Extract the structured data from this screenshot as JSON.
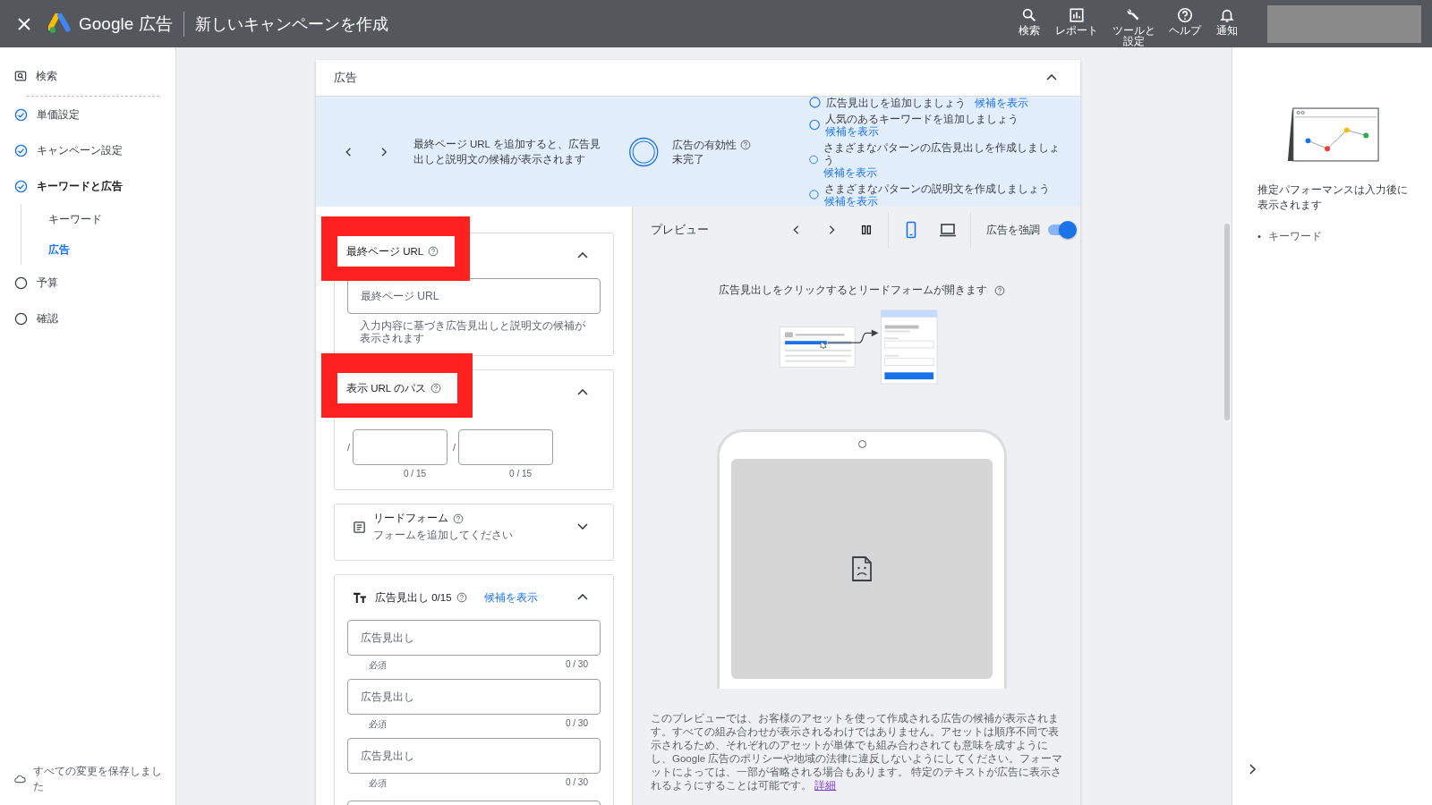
{
  "topbar": {
    "brand": "Google 広告",
    "title": "新しいキャンペーンを作成",
    "nav": [
      {
        "label": "検索",
        "kind": "search"
      },
      {
        "label": "レポート",
        "kind": "report"
      },
      {
        "label": "ツールと設定",
        "kind": "tools"
      },
      {
        "label": "ヘルプ",
        "kind": "help"
      },
      {
        "label": "通知",
        "kind": "bell"
      }
    ]
  },
  "sidebar": {
    "items": [
      {
        "label": "検索",
        "kind": "search",
        "selected": false
      },
      {
        "label": "単価設定",
        "kind": "done",
        "selected": false
      },
      {
        "label": "キャンペーン設定",
        "kind": "done",
        "selected": false
      },
      {
        "label": "キーワードと広告",
        "kind": "done",
        "selected": true,
        "children": [
          {
            "label": "キーワード",
            "selected": false
          },
          {
            "label": "広告",
            "selected": true
          }
        ]
      },
      {
        "label": "予算",
        "kind": "todo",
        "selected": false
      },
      {
        "label": "確認",
        "kind": "todo",
        "selected": false
      }
    ],
    "saved_status": "すべての変更を保存しました"
  },
  "card": {
    "title": "広告",
    "expanded": true,
    "banner": {
      "message": "最終ページ URL を追加すると、広告見出しと説明文の候補が表示されます",
      "effectiveness_label": "広告の有効性",
      "effectiveness_status": "未完了",
      "suggestions": [
        {
          "text": "広告見出しを追加しましょう",
          "link": "候補を表示"
        },
        {
          "text": "人気のあるキーワードを追加しましょう",
          "link": "候補を表示"
        },
        {
          "text": "さまざまなパターンの広告見出しを作成しましょう",
          "link": "候補を表示"
        },
        {
          "text": "さまざまなパターンの説明文を作成しましょう",
          "link": "候補を表示"
        }
      ]
    },
    "sections": [
      {
        "kind": "url",
        "title": "最終ページ URL",
        "highlighted": true,
        "expanded": true,
        "placeholder": "最終ページ URL",
        "hint": "入力内容に基づき広告見出しと説明文の候補が表示されます"
      },
      {
        "kind": "path",
        "title": "表示 URL のパス",
        "highlighted": true,
        "expanded": true,
        "paths": [
          {
            "separator": "/",
            "counter": "0 / 15"
          },
          {
            "separator": "/",
            "counter": "0 / 15"
          }
        ]
      },
      {
        "kind": "lead_form",
        "title": "リードフォーム",
        "subtitle": "フォームを追加してください",
        "highlighted": false,
        "expanded": false
      },
      {
        "kind": "headlines",
        "title": "広告見出し 0/15",
        "link": "候補を表示",
        "highlighted": false,
        "expanded": true,
        "fields": [
          {
            "placeholder": "広告見出し",
            "hint": "必須",
            "counter": "0 / 30"
          },
          {
            "placeholder": "広告見出し",
            "hint": "必須",
            "counter": "0 / 30"
          },
          {
            "placeholder": "広告見出し",
            "hint": "必須",
            "counter": "0 / 30"
          }
        ]
      }
    ],
    "preview": {
      "title": "プレビュー",
      "devices": [
        {
          "kind": "mobile",
          "selected": true
        },
        {
          "kind": "desktop",
          "selected": false
        }
      ],
      "emphasize_label": "広告を強調",
      "emphasize_on": true,
      "caption": "広告見出しをクリックするとリードフォームが開きます",
      "note": "このプレビューでは、お客様のアセットを使って作成される広告の候補が表示されます。すべての組み合わせが表示されるわけではありません。アセットは順序不同で表示されるため、それぞれのアセットが単体でも組み合わされても意味を成すようにし、Google 広告のポリシーや地域の法律に違反しないようにしてください。フォーマットによっては、一部が省略される場合もあります。 特定のテキストが広告に表示されるようにすることは可能です。",
      "note_link": "詳細"
    }
  },
  "side_panel": {
    "message": "推定パフォーマンスは入力後に表示されます",
    "bullets": [
      {
        "marker": "•",
        "text": "キーワード"
      }
    ]
  }
}
